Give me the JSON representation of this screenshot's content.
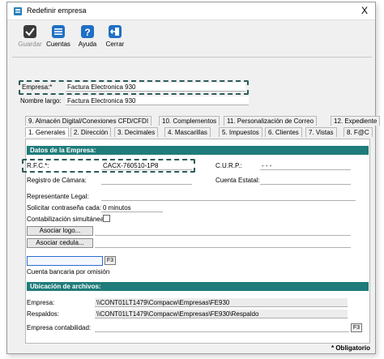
{
  "window": {
    "title": "Redefinir empresa",
    "close_glyph": "X"
  },
  "toolbar": [
    {
      "label": "Guardar",
      "icon": "save-check-icon",
      "enabled": false,
      "color": "#3a3a3a"
    },
    {
      "label": "Cuentas",
      "icon": "list-icon",
      "enabled": true,
      "color": "#1f6fc4"
    },
    {
      "label": "Ayuda",
      "icon": "help-icon",
      "enabled": true,
      "color": "#1f6fc4"
    },
    {
      "label": "Cerrar",
      "icon": "exit-icon",
      "enabled": true,
      "color": "#1f6fc4"
    }
  ],
  "header": {
    "empresa_label": "Empresa:*",
    "empresa_value": "Factura Electronica 930",
    "nombre_largo_label": "Nombre largo:",
    "nombre_largo_value": "Factura Electronica 930"
  },
  "tabs_row1": [
    "9. Almacén Digital/Conexiones CFD/CFDI",
    "10. Complementos",
    "11. Personalización de Correo",
    "12. Expediente"
  ],
  "tabs_row2": [
    "1. Generales",
    "2. Dirección",
    "3. Decimales",
    "4. Mascarillas",
    "5. Impuestos",
    "6. Clientes",
    "7. Vistas",
    "8. F@C"
  ],
  "active_tab": "1. Generales",
  "datos": {
    "title": "Datos de la Empresa:",
    "rfc_label": "R.F.C.*:",
    "rfc_value": "CACX-760510-1P8",
    "curp_label": "C.U.R.P.:",
    "curp_value": "-      -      -",
    "registro_label": "Registro de Cámara:",
    "cuenta_estatal_label": "Cuenta Estatal:",
    "representante_label": "Representante Legal:",
    "solicitar_label": "Solicitar contraseña cada:",
    "solicitar_value": "0  minutos",
    "contabilizacion_label": "Contabilización simultánea:",
    "asociar_logo": "Asociar logo...",
    "asociar_cedula": "Asociar cedula...",
    "f3": "F3",
    "cuenta_bancaria_label": "Cuenta bancaria por omisión"
  },
  "ubicacion": {
    "title": "Ubicación de archivos:",
    "empresa_label": "Empresa:",
    "empresa_value": "\\\\CONT01LT1479\\Compacw\\Empresas\\FE930",
    "respaldos_label": "Respaldos:",
    "respaldos_value": "\\\\CONT01LT1479\\Compacw\\Empresas\\FE930\\Respaldo",
    "contable_label": "Empresa contabilidad:",
    "f3": "F3"
  },
  "footer": {
    "obligatorio": "* Obligatorio"
  },
  "colors": {
    "accent": "#1f7c7a",
    "dash": "#2d5b5a"
  }
}
